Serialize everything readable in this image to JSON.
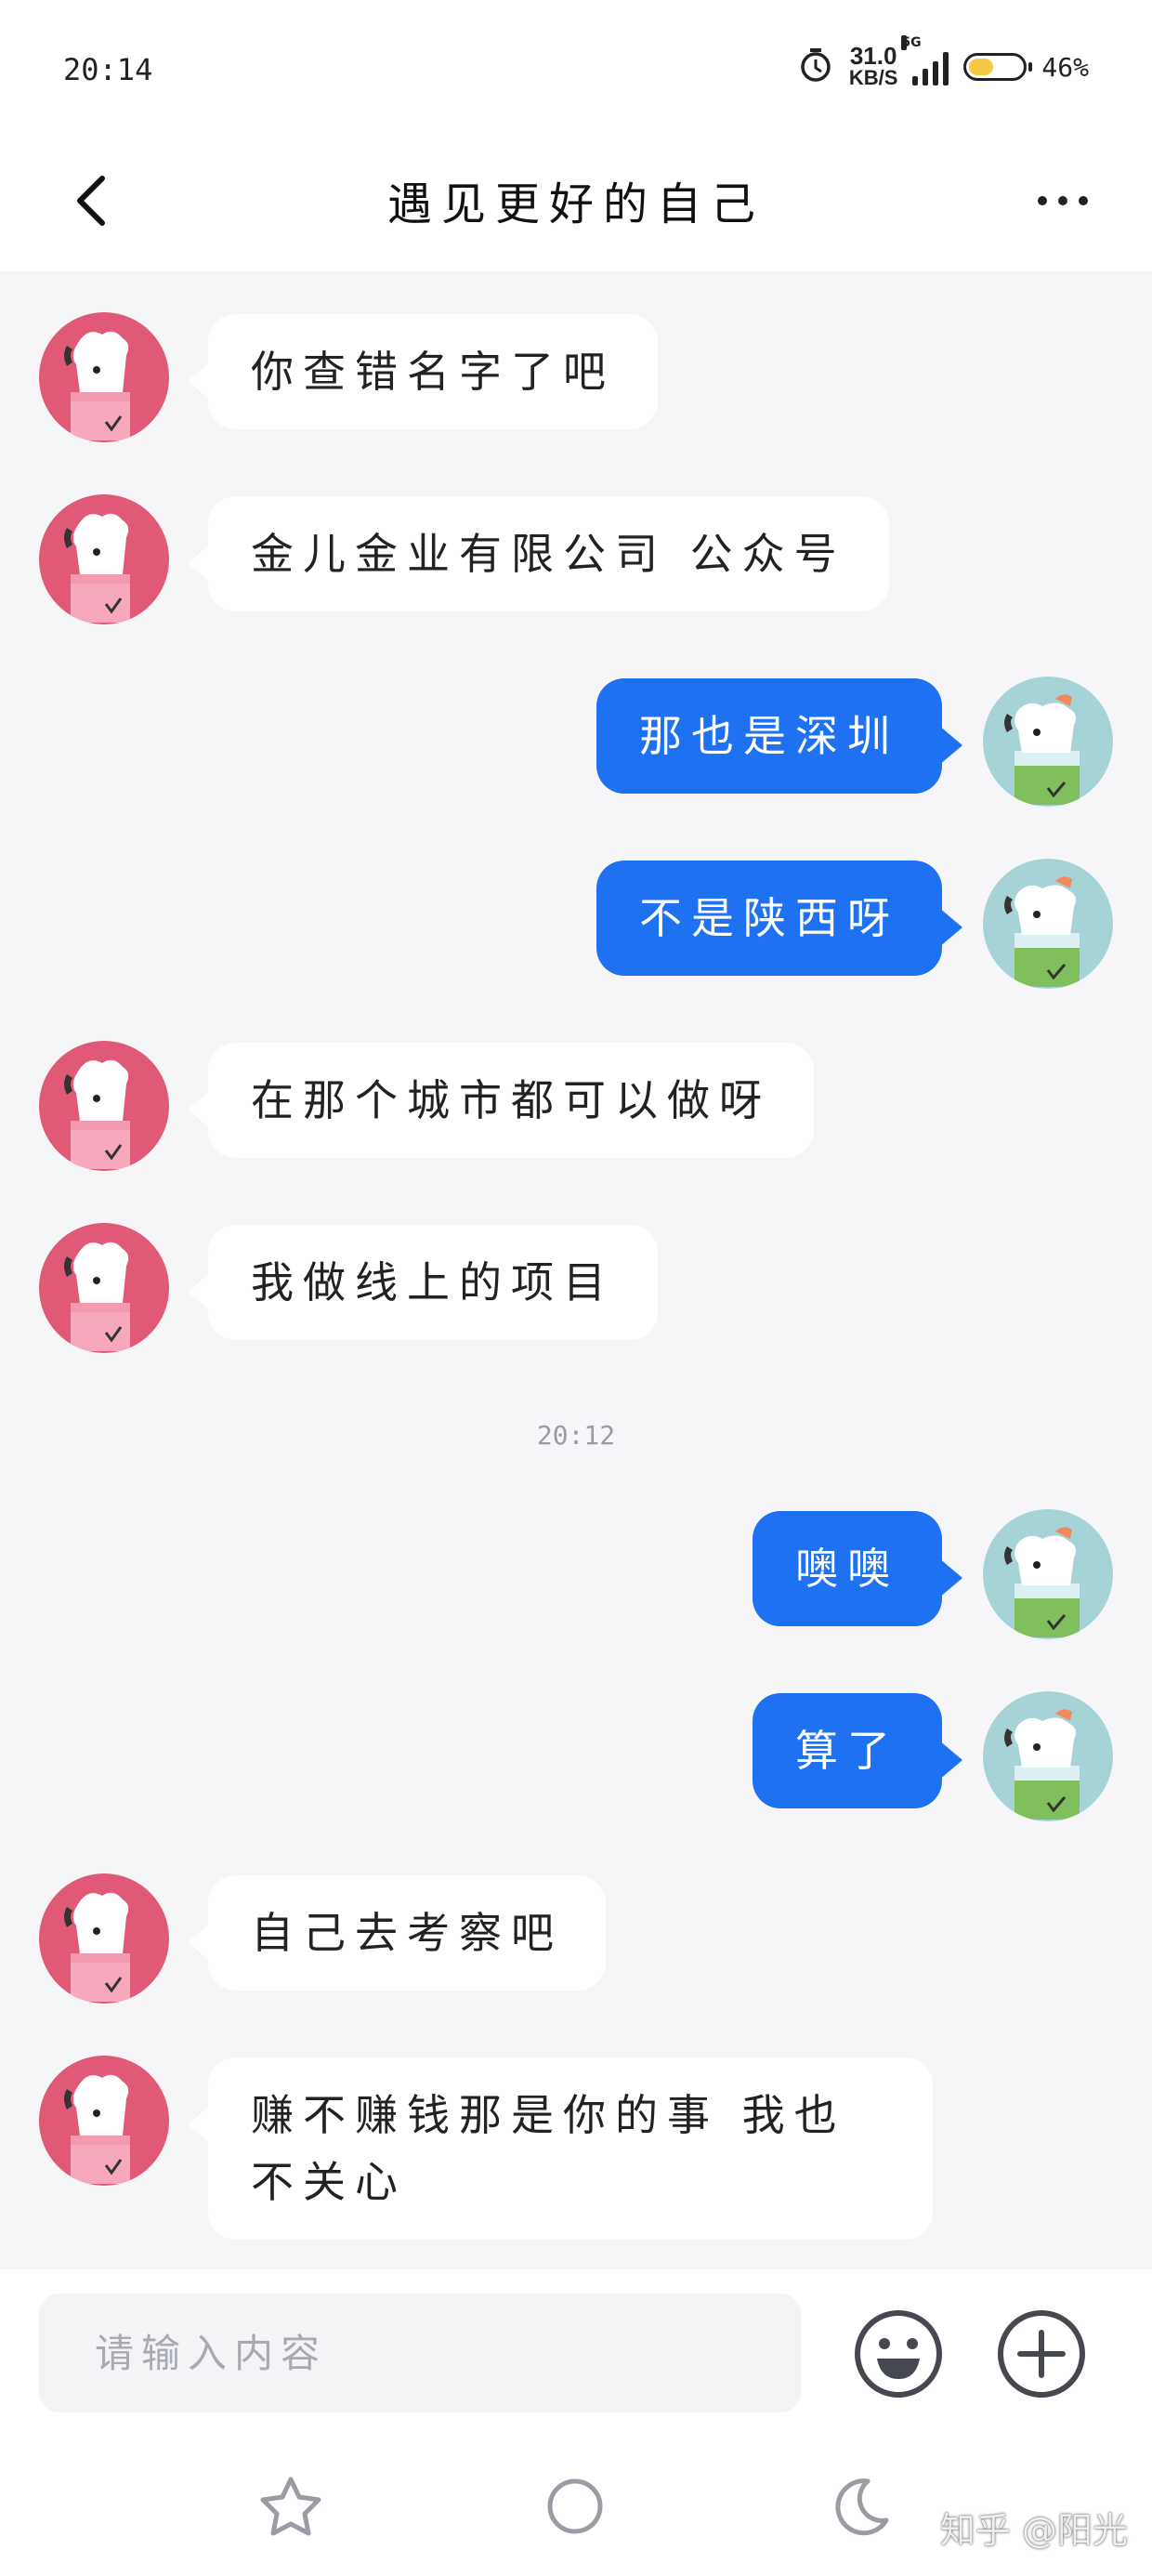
{
  "status_bar": {
    "time": "20:14",
    "net_speed_value": "31.0",
    "net_speed_unit": "KB/S",
    "network_type": "5G",
    "battery_percent": "46%",
    "battery_level": 0.46,
    "icons": [
      "alarm-icon",
      "signal-icon",
      "battery-icon"
    ]
  },
  "header": {
    "title": "遇见更好的自己"
  },
  "messages": [
    {
      "side": "left",
      "text": "你查错名字了吧"
    },
    {
      "side": "left",
      "text": "金儿金业有限公司  公众号"
    },
    {
      "side": "right",
      "text": "那也是深圳"
    },
    {
      "side": "right",
      "text": "不是陕西呀"
    },
    {
      "side": "left",
      "text": "在那个城市都可以做呀"
    },
    {
      "side": "left",
      "text": "我做线上的项目"
    },
    {
      "type": "time",
      "text": "20:12"
    },
    {
      "side": "right",
      "text": "噢噢"
    },
    {
      "side": "right",
      "text": "算了"
    },
    {
      "side": "left",
      "text": "自己去考察吧"
    },
    {
      "side": "left",
      "text": "赚不赚钱那是你的事    我也不关心"
    }
  ],
  "input": {
    "placeholder": "请输入内容",
    "value": ""
  },
  "colors": {
    "accent": "#1e71f0",
    "background": "#f6f6f9",
    "other_avatar": "#e05a78",
    "self_avatar": "#a6d4d6"
  },
  "watermark": "知乎 @阳光"
}
